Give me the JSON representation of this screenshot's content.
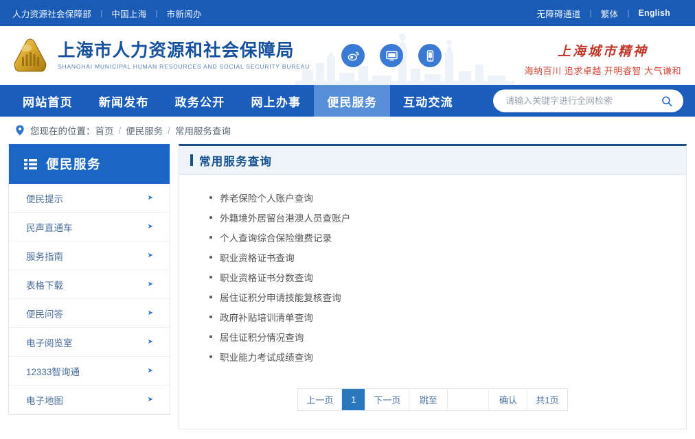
{
  "topbar": {
    "left_links": [
      "人力资源社会保障部",
      "中国上海",
      "市新闻办"
    ],
    "right_links": [
      "无障碍通道",
      "繁体",
      "English"
    ],
    "separator": "|",
    "background": "#1a5cb5"
  },
  "masthead": {
    "brand_cn": "上海市人力资源和社会保障局",
    "brand_en": "SHANGHAI MUNICIPAL HUMAN RESOURCES AND SOCIAL SECURITY BUREAU",
    "logo_icon": "shield-emblem-icon",
    "social": [
      {
        "icon": "weibo-icon",
        "label": "微博"
      },
      {
        "icon": "desktop-icon",
        "label": "网站"
      },
      {
        "icon": "mobile-icon",
        "label": "手机版"
      }
    ],
    "spirit_title": "上海城市精神",
    "spirit_subtitle": "海纳百川 追求卓越 开明睿智 大气谦和",
    "spirit_color": "#c0392b"
  },
  "nav": {
    "items": [
      {
        "label": "网站首页",
        "active": false
      },
      {
        "label": "新闻发布",
        "active": false
      },
      {
        "label": "政务公开",
        "active": false
      },
      {
        "label": "网上办事",
        "active": false
      },
      {
        "label": "便民服务",
        "active": true
      },
      {
        "label": "互动交流",
        "active": false
      }
    ],
    "background": "#1b5dbb",
    "active_background": "#5790d8"
  },
  "search": {
    "placeholder": "请输入关键字进行全网检索",
    "value": "",
    "icon": "search-icon"
  },
  "breadcrumb": {
    "pin_icon": "location-pin-icon",
    "label": "您现在的位置：",
    "items": [
      "首页",
      "便民服务",
      "常用服务查询"
    ],
    "separator": "/"
  },
  "sidebar": {
    "header_icon": "menu-list-icon",
    "header_title": "便民服务",
    "arrow_icon": "arrow-right-icon",
    "items": [
      {
        "label": "便民提示"
      },
      {
        "label": "民声直通车"
      },
      {
        "label": "服务指南"
      },
      {
        "label": "表格下载"
      },
      {
        "label": "便民问答"
      },
      {
        "label": "电子阅览室"
      },
      {
        "label": "12333智询通"
      },
      {
        "label": "电子地图"
      }
    ]
  },
  "content": {
    "title": "常用服务查询",
    "accent_color": "#15528f",
    "services": [
      {
        "label": "养老保险个人账户查询"
      },
      {
        "label": "外籍境外居留台港澳人员查账户"
      },
      {
        "label": "个人查询综合保险缴费记录"
      },
      {
        "label": "职业资格证书查询"
      },
      {
        "label": "职业资格证书分数查询"
      },
      {
        "label": "居住证积分申请技能复核查询"
      },
      {
        "label": "政府补贴培训清单查询"
      },
      {
        "label": "居住证积分情况查询"
      },
      {
        "label": "职业能力考试成绩查询"
      }
    ]
  },
  "pagination": {
    "prev_label": "上一页",
    "current_page": "1",
    "next_label": "下一页",
    "jump_label": "跳至",
    "jump_value": "",
    "confirm_label": "确认",
    "total_label": "共1页",
    "active_color": "#2a77bd"
  }
}
